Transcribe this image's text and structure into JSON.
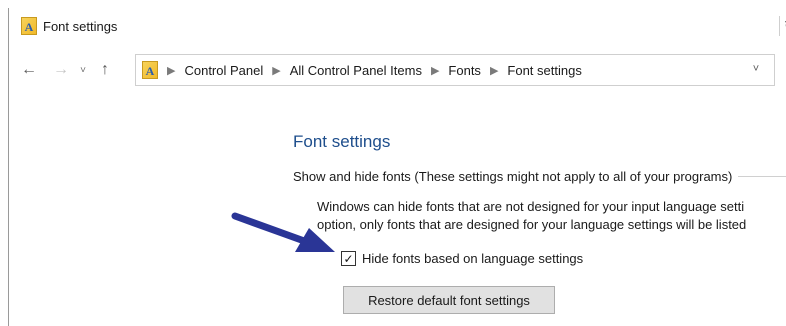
{
  "window": {
    "title": "Font settings",
    "app_icon": "font-settings-icon",
    "app_icon_glyph": "A"
  },
  "nav": {
    "back_icon": "back-arrow-icon",
    "forward_icon": "forward-arrow-icon",
    "recent_icon": "chevron-down-icon",
    "up_icon": "up-arrow-icon"
  },
  "address": {
    "crumbs": [
      "Control Panel",
      "All Control Panel Items",
      "Fonts",
      "Font settings"
    ],
    "dropdown_icon": "chevron-down-icon",
    "refresh_icon": "refresh-icon"
  },
  "main": {
    "title": "Font settings",
    "group_label": "Show and hide fonts (These settings might not apply to all of your programs)",
    "description_line1": "Windows can hide fonts that are not designed for your input language setti",
    "description_line2": "option, only fonts that are designed for your language settings will be listed",
    "checkbox_label": "Hide fonts based on language settings",
    "checkbox_checked": true,
    "restore_button": "Restore default font settings"
  },
  "annotation": {
    "arrow_color": "#2a3596"
  }
}
